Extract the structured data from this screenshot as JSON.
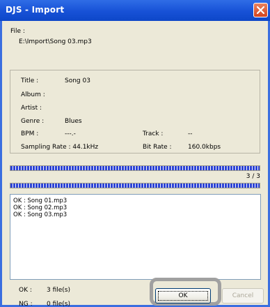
{
  "window": {
    "title": "DJS - Import"
  },
  "file": {
    "label": "File :",
    "path": "E:\\Import\\Song 03.mp3"
  },
  "info": {
    "title_label": "Title :",
    "title_value": "Song 03",
    "album_label": "Album :",
    "artist_label": "Artist :",
    "genre_label": "Genre :",
    "genre_value": "Blues",
    "bpm_label": "BPM :",
    "bpm_value": "---.-",
    "track_label": "Track :",
    "track_value": "--",
    "sampling_label": "Sampling Rate : 44.1kHz",
    "bitrate_label": "Bit Rate :",
    "bitrate_value": "160.0kbps"
  },
  "progress": {
    "file_fraction": 1.0,
    "total_fraction": 1.0,
    "counter": "3 / 3"
  },
  "log": {
    "lines": [
      "OK : Song 01.mp3",
      "OK : Song 02.mp3",
      "OK : Song 03.mp3"
    ]
  },
  "summary": {
    "ok_label": "OK :",
    "ok_value": "3 file(s)",
    "ng_label": "NG :",
    "ng_value": "0 file(s)"
  },
  "buttons": {
    "ok": "OK",
    "cancel": "Cancel"
  },
  "colors": {
    "titlebar": "#1751d6",
    "progress": "#2c43d6",
    "highlight_frame": "#a0a0a0"
  },
  "icons": {
    "close": "close-icon"
  }
}
